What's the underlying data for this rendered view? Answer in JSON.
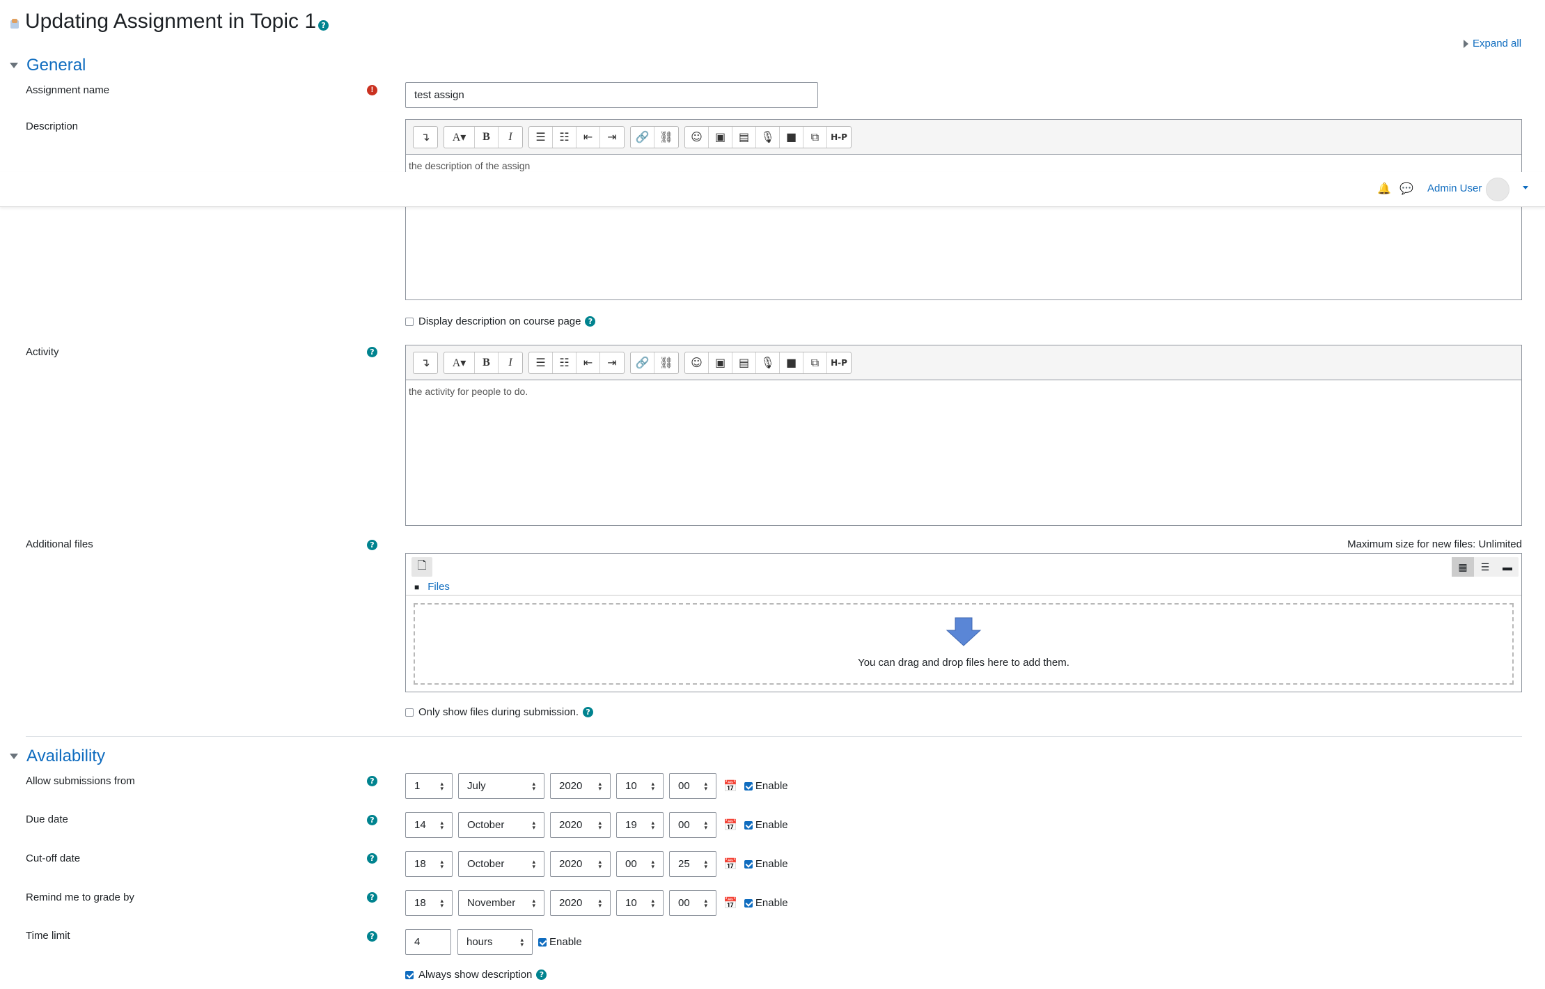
{
  "page": {
    "title": "Updating Assignment in Topic 1",
    "expand_all": "Expand all"
  },
  "header": {
    "user_name": "Admin User"
  },
  "general": {
    "title": "General",
    "assignment_name_label": "Assignment name",
    "assignment_name_value": "test assign",
    "description_label": "Description",
    "description_text": "the description of the assign",
    "display_description_label": "Display description on course page",
    "activity_label": "Activity",
    "activity_text": "the activity for people to do.",
    "additional_files_label": "Additional files",
    "max_size": "Maximum size for new files: Unlimited",
    "files_link": "Files",
    "drop_text": "You can drag and drop files here to add them.",
    "only_show_files_label": "Only show files during submission."
  },
  "toolbar": {
    "buttons": [
      "↴",
      "A▾",
      "B",
      "I",
      "list-bullet",
      "list-number",
      "outdent",
      "indent",
      "link",
      "unlink",
      "emoji",
      "image",
      "media-file",
      "record-audio",
      "record-video",
      "manage-files",
      "H-P"
    ]
  },
  "availability": {
    "title": "Availability",
    "rows": [
      {
        "label": "Allow submissions from",
        "day": "1",
        "month": "July",
        "year": "2020",
        "hour": "10",
        "minute": "00",
        "enable": "Enable"
      },
      {
        "label": "Due date",
        "day": "14",
        "month": "October",
        "year": "2020",
        "hour": "19",
        "minute": "00",
        "enable": "Enable"
      },
      {
        "label": "Cut-off date",
        "day": "18",
        "month": "October",
        "year": "2020",
        "hour": "00",
        "minute": "25",
        "enable": "Enable"
      },
      {
        "label": "Remind me to grade by",
        "day": "18",
        "month": "November",
        "year": "2020",
        "hour": "10",
        "minute": "00",
        "enable": "Enable"
      }
    ],
    "time_limit_label": "Time limit",
    "time_limit_value": "4",
    "time_limit_unit": "hours",
    "time_limit_enable": "Enable",
    "always_show_label": "Always show description"
  },
  "colors": {
    "accent": "#0f6cbf",
    "help": "#00838f",
    "error": "#ca3120"
  }
}
